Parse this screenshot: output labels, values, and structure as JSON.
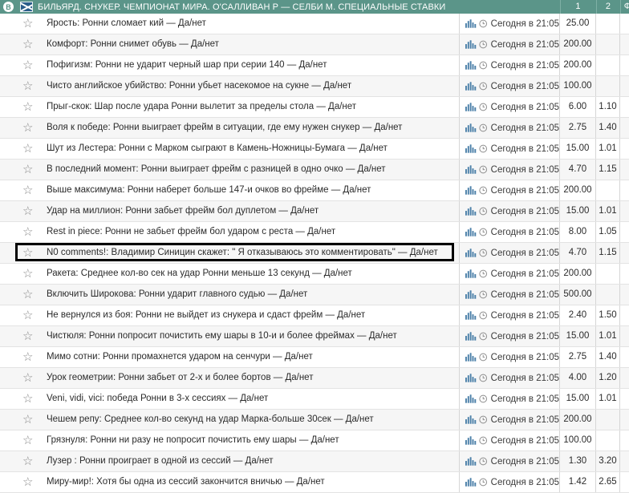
{
  "header": {
    "badge": "B",
    "title": "БИЛЬЯРД. СНУКЕР. ЧЕМПИОНАТ МИРА. О'САЛЛИВАН Р — СЕЛБИ М. СПЕЦИАЛЬНЫЕ СТАВКИ",
    "col1": "1",
    "col2": "2",
    "col3": "Ф"
  },
  "rows": [
    {
      "title": "Ярость: Ронни сломает кий — Да/нет",
      "time": "Сегодня в 21:05",
      "odds1": "25.00",
      "odds2": ""
    },
    {
      "title": "Комфорт: Ронни снимет обувь — Да/нет",
      "time": "Сегодня в 21:05",
      "odds1": "200.00",
      "odds2": ""
    },
    {
      "title": "Пофигизм: Ронни не ударит черный шар при серии 140 — Да/нет",
      "time": "Сегодня в 21:05",
      "odds1": "200.00",
      "odds2": ""
    },
    {
      "title": "Чисто английское убийство: Ронни убьет насекомое на сукне — Да/нет",
      "time": "Сегодня в 21:05",
      "odds1": "100.00",
      "odds2": ""
    },
    {
      "title": "Прыг-скок: Шар после удара Ронни вылетит за пределы стола — Да/нет",
      "time": "Сегодня в 21:05",
      "odds1": "6.00",
      "odds2": "1.10"
    },
    {
      "title": "Воля к победе: Ронни выиграет фрейм в ситуации, где ему нужен снукер — Да/нет",
      "time": "Сегодня в 21:05",
      "odds1": "2.75",
      "odds2": "1.40"
    },
    {
      "title": "Шут из Лестера: Ронни с Марком сыграют в Камень-Ножницы-Бумага — Да/нет",
      "time": "Сегодня в 21:05",
      "odds1": "15.00",
      "odds2": "1.01"
    },
    {
      "title": "В последний момент: Ронни выиграет фрейм с разницей в одно очко — Да/нет",
      "time": "Сегодня в 21:05",
      "odds1": "4.70",
      "odds2": "1.15"
    },
    {
      "title": "Выше максимума: Ронни наберет больше 147-и очков во фрейме — Да/нет",
      "time": "Сегодня в 21:05",
      "odds1": "200.00",
      "odds2": ""
    },
    {
      "title": "Удар на миллион: Ронни забьет фрейм бол дуплетом — Да/нет",
      "time": "Сегодня в 21:05",
      "odds1": "15.00",
      "odds2": "1.01"
    },
    {
      "title": "Rest in piece: Ронни не забьет фрейм бол ударом с реста — Да/нет",
      "time": "Сегодня в 21:05",
      "odds1": "8.00",
      "odds2": "1.05"
    },
    {
      "title": "N0 comments!: Владимир Синицин скажет: \" Я отказываюсь это комментировать\" — Да/нет",
      "time": "Сегодня в 21:05",
      "odds1": "4.70",
      "odds2": "1.15"
    },
    {
      "title": "Ракета: Среднее кол-во сек на удар Ронни меньше 13 секунд — Да/нет",
      "time": "Сегодня в 21:05",
      "odds1": "200.00",
      "odds2": ""
    },
    {
      "title": "Включить Широкова: Ронни ударит главного судью — Да/нет",
      "time": "Сегодня в 21:05",
      "odds1": "500.00",
      "odds2": ""
    },
    {
      "title": "Не вернулся из боя: Ронни не выйдет из снукера и сдаст фрейм — Да/нет",
      "time": "Сегодня в 21:05",
      "odds1": "2.40",
      "odds2": "1.50"
    },
    {
      "title": "Чистюля: Ронни попросит почистить ему шары в 10-и и более фреймах — Да/нет",
      "time": "Сегодня в 21:05",
      "odds1": "15.00",
      "odds2": "1.01"
    },
    {
      "title": "Мимо сотни: Ронни промахнется ударом на сенчури — Да/нет",
      "time": "Сегодня в 21:05",
      "odds1": "2.75",
      "odds2": "1.40"
    },
    {
      "title": "Урок геометрии: Ронни забьет от 2-х и более бортов — Да/нет",
      "time": "Сегодня в 21:05",
      "odds1": "4.00",
      "odds2": "1.20"
    },
    {
      "title": "Veni, vidi, vici: победа Ронни в 3-х сессиях — Да/нет",
      "time": "Сегодня в 21:05",
      "odds1": "15.00",
      "odds2": "1.01"
    },
    {
      "title": "Чешем репу: Среднее кол-во секунд на удар Марка-больше 30сек — Да/нет",
      "time": "Сегодня в 21:05",
      "odds1": "200.00",
      "odds2": ""
    },
    {
      "title": "Грязнуля: Ронни ни разу не попросит почистить ему шары — Да/нет",
      "time": "Сегодня в 21:05",
      "odds1": "100.00",
      "odds2": ""
    },
    {
      "title": "Лузер : Ронни проиграет в одной из сессий — Да/нет",
      "time": "Сегодня в 21:05",
      "odds1": "1.30",
      "odds2": "3.20"
    },
    {
      "title": "Миру-мир!: Хотя бы одна из сессий закончится вничью — Да/нет",
      "time": "Сегодня в 21:05",
      "odds1": "1.42",
      "odds2": "2.65"
    }
  ],
  "colors": {
    "header_bg": "#5b9589",
    "highlight_border": "#000000",
    "stats_icon": "#4a7fa8"
  },
  "icons": {
    "star": "star-icon",
    "stats": "stats-icon",
    "clock": "clock-icon",
    "flag": "uk-flag-icon"
  }
}
